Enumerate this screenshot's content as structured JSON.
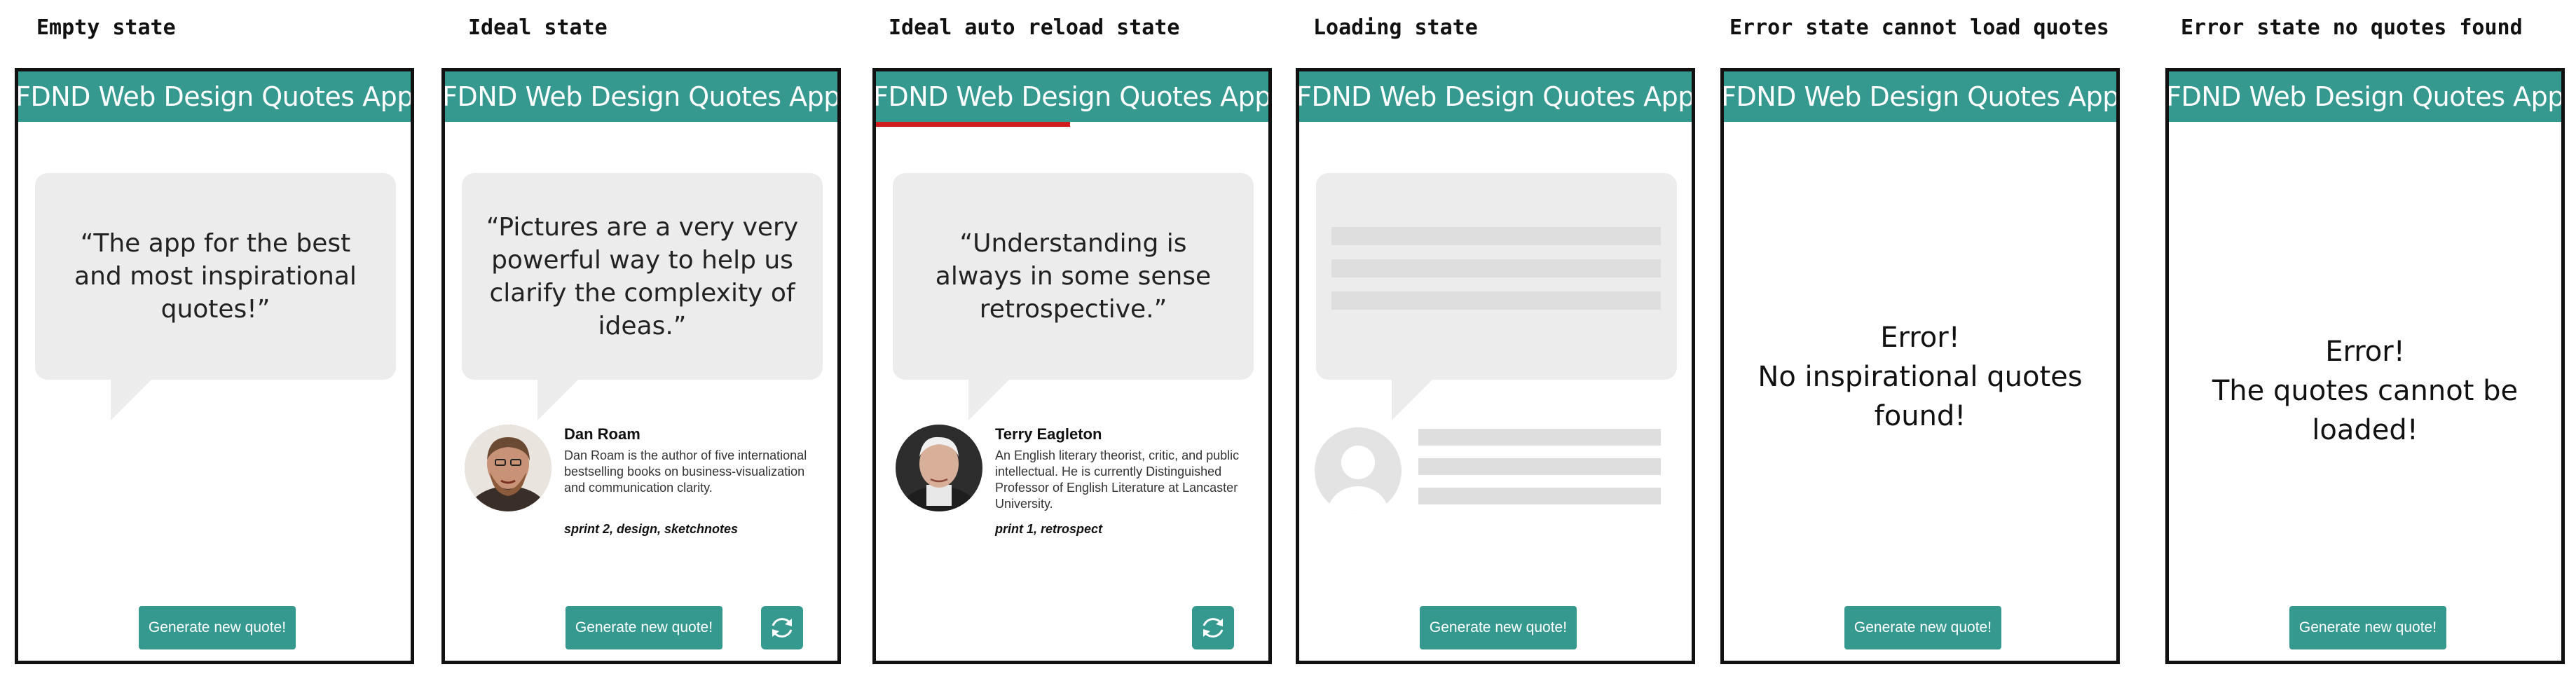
{
  "app_title": "FDND Web Design Quotes App",
  "generate_label": "Generate new quote!",
  "colors": {
    "brand": "#36998f",
    "bubble": "#ececec",
    "reload_progress": "#d11d1d",
    "skeleton": "#dedede"
  },
  "states": [
    {
      "label": "Empty state",
      "quote": "“The app for the best and most inspirational quotes!”"
    },
    {
      "label": "Ideal state",
      "quote": "“Pictures are a very very powerful way to help us clarify the complexity of ideas.”",
      "author": "Dan Roam",
      "bio": "Dan Roam is the author of five international bestselling books on business-visualization and communication clarity.",
      "tags": "sprint 2, design, sketchnotes",
      "reload_icon": "refresh-icon"
    },
    {
      "label": "Ideal auto reload state",
      "quote": "“Understanding is always in some sense retrospective.”",
      "author": "Terry Eagleton",
      "bio": "An English literary theorist, critic, and public intellectual. He is currently Distinguished Professor of English Literature at Lancaster University.",
      "tags": "print 1, retrospect",
      "reload_icon": "refresh-icon"
    },
    {
      "label": "Loading state"
    },
    {
      "label": "Error state cannot load quotes",
      "error_line1": "Error!",
      "error_line2": "No inspirational quotes",
      "error_line3": "found!"
    },
    {
      "label": "Error state no quotes found",
      "error_line1": "Error!",
      "error_line2": "The quotes cannot be loaded!"
    }
  ]
}
